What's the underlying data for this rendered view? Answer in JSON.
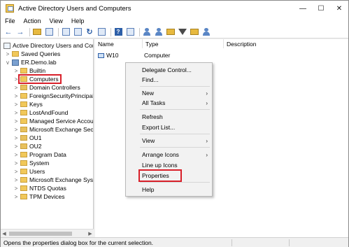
{
  "window": {
    "title": "Active Directory Users and Computers"
  },
  "window_controls": {
    "minimize": "—",
    "maximize": "☐",
    "close": "✕"
  },
  "menu": [
    "File",
    "Action",
    "View",
    "Help"
  ],
  "toolbar": {
    "icons": [
      "back-arrow-icon",
      "forward-arrow-icon",
      "up-folder-icon",
      "console-tree-icon",
      "properties-icon",
      "copy-icon",
      "refresh-icon",
      "export-list-icon",
      "help-icon",
      "console-icon",
      "new-user-icon",
      "new-group-icon",
      "filter-icon",
      "add-to-group-icon",
      "find-icon"
    ]
  },
  "tree": {
    "root": "Active Directory Users and Com",
    "items": [
      {
        "label": "Saved Queries",
        "level": 1,
        "arrow": ">",
        "icon": "folder"
      },
      {
        "label": "ER.Demo.lab",
        "level": 1,
        "arrow": "v",
        "icon": "domain"
      },
      {
        "label": "Builtin",
        "level": 2,
        "arrow": ">",
        "icon": "folder"
      },
      {
        "label": "Computers",
        "level": 2,
        "arrow": ">",
        "icon": "folder",
        "selected": true
      },
      {
        "label": "Domain Controllers",
        "level": 2,
        "arrow": ">",
        "icon": "folder-special"
      },
      {
        "label": "ForeignSecurityPrincipals",
        "level": 2,
        "arrow": ">",
        "icon": "folder"
      },
      {
        "label": "Keys",
        "level": 2,
        "arrow": ">",
        "icon": "folder"
      },
      {
        "label": "LostAndFound",
        "level": 2,
        "arrow": ">",
        "icon": "folder"
      },
      {
        "label": "Managed Service Accour",
        "level": 2,
        "arrow": ">",
        "icon": "folder"
      },
      {
        "label": "Microsoft Exchange Secu",
        "level": 2,
        "arrow": ">",
        "icon": "folder-special"
      },
      {
        "label": "OU1",
        "level": 2,
        "arrow": ">",
        "icon": "folder-special"
      },
      {
        "label": "OU2",
        "level": 2,
        "arrow": ">",
        "icon": "folder-special"
      },
      {
        "label": "Program Data",
        "level": 2,
        "arrow": ">",
        "icon": "folder"
      },
      {
        "label": "System",
        "level": 2,
        "arrow": ">",
        "icon": "folder"
      },
      {
        "label": "Users",
        "level": 2,
        "arrow": ">",
        "icon": "folder"
      },
      {
        "label": "Microsoft Exchange Syste",
        "level": 2,
        "arrow": ">",
        "icon": "folder"
      },
      {
        "label": "NTDS Quotas",
        "level": 2,
        "arrow": ">",
        "icon": "folder"
      },
      {
        "label": "TPM Devices",
        "level": 2,
        "arrow": ">",
        "icon": "folder"
      }
    ]
  },
  "content": {
    "columns": [
      "Name",
      "Type",
      "Description"
    ],
    "rows": [
      {
        "name": "W10",
        "type": "Computer",
        "description": ""
      }
    ]
  },
  "context_menu": {
    "items": [
      {
        "label": "Delegate Control...",
        "submenu": false
      },
      {
        "label": "Find...",
        "submenu": false
      },
      {
        "sep": true
      },
      {
        "label": "New",
        "submenu": true
      },
      {
        "label": "All Tasks",
        "submenu": true
      },
      {
        "sep": true
      },
      {
        "label": "Refresh",
        "submenu": false
      },
      {
        "label": "Export List...",
        "submenu": false
      },
      {
        "sep": true
      },
      {
        "label": "View",
        "submenu": true
      },
      {
        "sep": true
      },
      {
        "label": "Arrange Icons",
        "submenu": true
      },
      {
        "label": "Line up Icons",
        "submenu": false
      },
      {
        "label": "Properties",
        "submenu": false,
        "highlighted": true
      },
      {
        "sep": true
      },
      {
        "label": "Help",
        "submenu": false
      }
    ]
  },
  "status": {
    "text": "Opens the properties dialog box for the current selection."
  },
  "colors": {
    "highlight_box": "#d8202a",
    "folder": "#f1c85a",
    "accent": "#2d5fa8"
  }
}
